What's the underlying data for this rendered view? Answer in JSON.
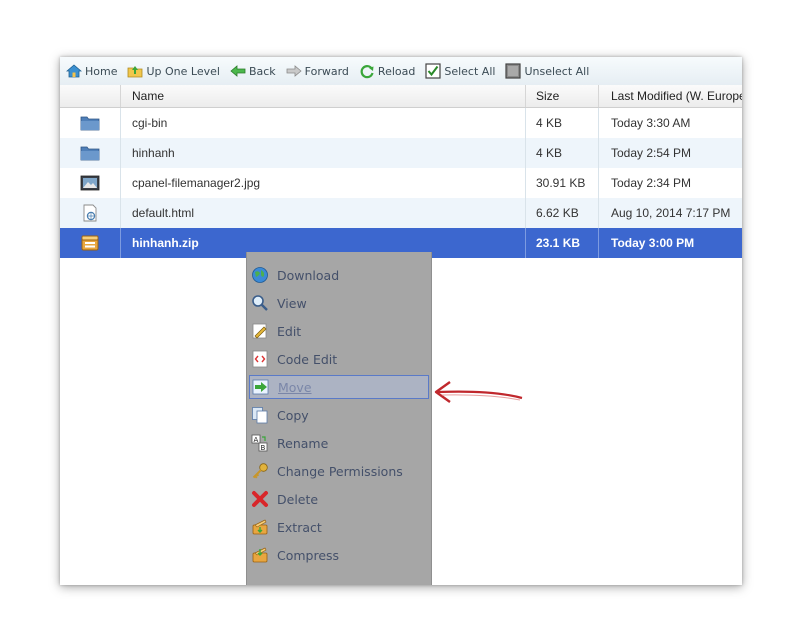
{
  "toolbar": {
    "home": "Home",
    "up": "Up One Level",
    "back": "Back",
    "forward": "Forward",
    "reload": "Reload",
    "select_all": "Select All",
    "unselect_all": "Unselect All"
  },
  "columns": {
    "name": "Name",
    "size": "Size",
    "modified": "Last Modified (W. Europe"
  },
  "files": [
    {
      "name": "cgi-bin",
      "size": "4 KB",
      "modified": "Today 3:30 AM",
      "icon": "folder-icon"
    },
    {
      "name": "hinhanh",
      "size": "4 KB",
      "modified": "Today 2:54 PM",
      "icon": "folder-icon"
    },
    {
      "name": "cpanel-filemanager2.jpg",
      "size": "30.91 KB",
      "modified": "Today 2:34 PM",
      "icon": "image-file-icon"
    },
    {
      "name": "default.html",
      "size": "6.62 KB",
      "modified": "Aug 10, 2014 7:17 PM",
      "icon": "html-file-icon"
    },
    {
      "name": "hinhanh.zip",
      "size": "23.1 KB",
      "modified": "Today 3:00 PM",
      "icon": "archive-file-icon"
    }
  ],
  "context_menu": [
    {
      "label": "Download",
      "icon": "globe-download-icon"
    },
    {
      "label": "View",
      "icon": "magnifier-icon"
    },
    {
      "label": "Edit",
      "icon": "pencil-icon"
    },
    {
      "label": "Code Edit",
      "icon": "code-edit-icon"
    },
    {
      "label": "Move",
      "icon": "move-arrow-icon"
    },
    {
      "label": "Copy",
      "icon": "copy-icon"
    },
    {
      "label": "Rename",
      "icon": "rename-icon"
    },
    {
      "label": "Change Permissions",
      "icon": "key-icon"
    },
    {
      "label": "Delete",
      "icon": "delete-x-icon"
    },
    {
      "label": "Extract",
      "icon": "extract-icon"
    },
    {
      "label": "Compress",
      "icon": "compress-icon"
    }
  ],
  "colors": {
    "selection": "#3c67cf",
    "menu_bg": "#a6a6a6",
    "arrow": "#c0282d"
  }
}
